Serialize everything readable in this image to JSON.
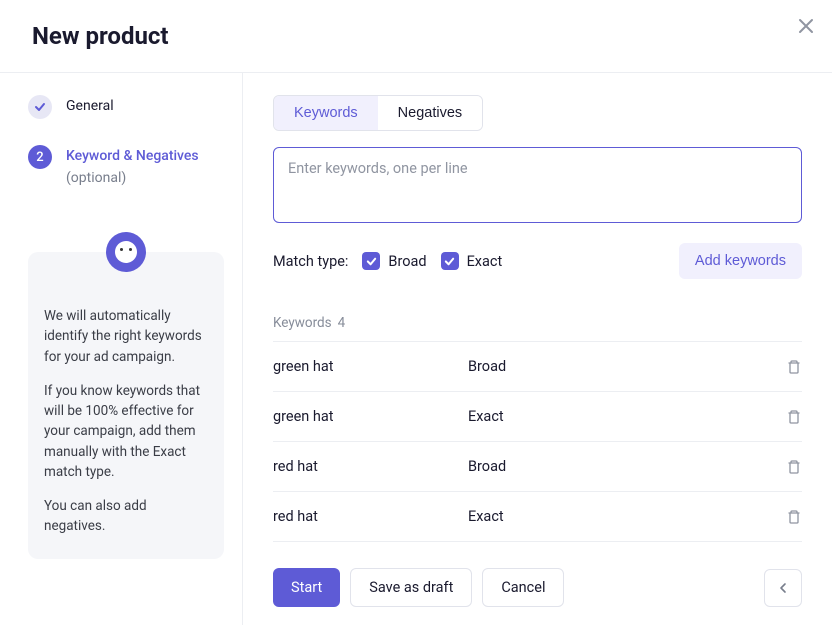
{
  "header": {
    "title": "New product"
  },
  "sidebar": {
    "steps": [
      {
        "label": "General",
        "state": "done"
      },
      {
        "label": "Keyword & Negatives",
        "sub": "(optional)",
        "state": "current",
        "number": "2"
      }
    ],
    "info": {
      "p1": "We will automatically identify the right keywords for your ad campaign.",
      "p2": "If you know keywords that will be 100% effective for your campaign, add them manually with the Exact match type.",
      "p3": "You can also add negatives."
    }
  },
  "main": {
    "tabs": [
      {
        "label": "Keywords",
        "active": true
      },
      {
        "label": "Negatives",
        "active": false
      }
    ],
    "input": {
      "placeholder": "Enter keywords, one per line"
    },
    "match": {
      "label": "Match type:",
      "broad": "Broad",
      "exact": "Exact",
      "add_btn": "Add keywords"
    },
    "list": {
      "title": "Keywords",
      "count": "4",
      "rows": [
        {
          "name": "green hat",
          "match": "Broad"
        },
        {
          "name": "green hat",
          "match": "Exact"
        },
        {
          "name": "red hat",
          "match": "Broad"
        },
        {
          "name": "red hat",
          "match": "Exact"
        }
      ]
    }
  },
  "footer": {
    "start": "Start",
    "draft": "Save as draft",
    "cancel": "Cancel"
  }
}
